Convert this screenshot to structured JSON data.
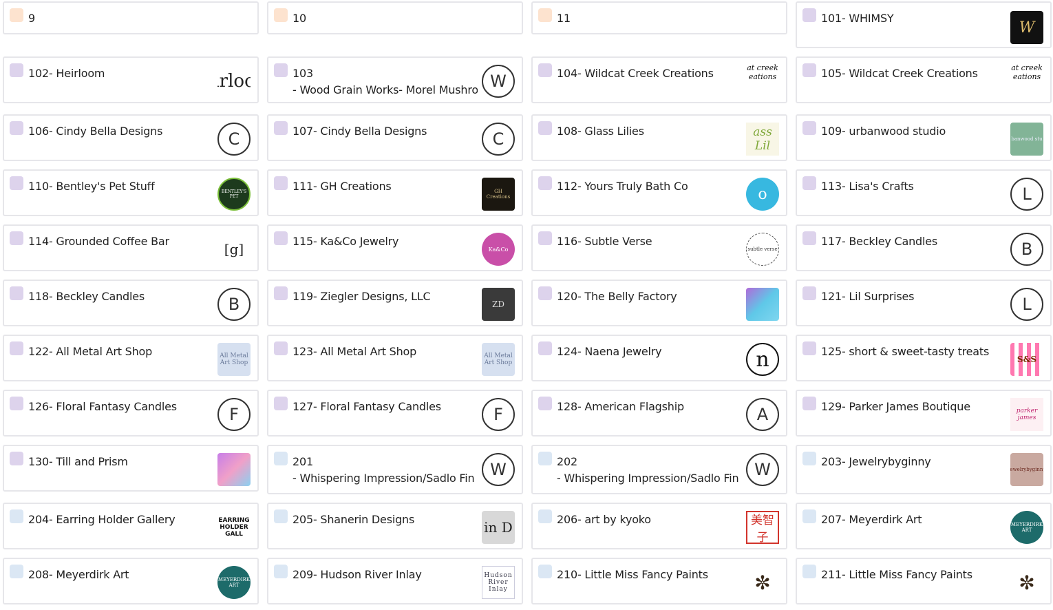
{
  "cards": [
    {
      "label": "9"
    },
    {
      "label": "10"
    },
    {
      "label": "11"
    },
    {
      "label": "101- WHIMSY",
      "thumb": "W"
    },
    {
      "label": "102- Heirloom",
      "thumb": "irloc"
    },
    {
      "label": "103",
      "label2": "- Wood Grain Works- Morel Mushro",
      "thumb": "W"
    },
    {
      "label": "104- Wildcat Creek Creations",
      "thumb": "at creek eations"
    },
    {
      "label": "105- Wildcat Creek Creations",
      "thumb": "at creek eations"
    },
    {
      "label": "106- Cindy Bella Designs",
      "thumb": "C"
    },
    {
      "label": "107- Cindy Bella Designs",
      "thumb": "C"
    },
    {
      "label": "108- Glass Lilies",
      "thumb": "ass Lil"
    },
    {
      "label": "109- urbanwood studio",
      "thumb": "banwood stu"
    },
    {
      "label": "110- Bentley's Pet Stuff",
      "thumb": "BENTLEY'S PET"
    },
    {
      "label": "111- GH Creations",
      "thumb": "GH Creations"
    },
    {
      "label": "112- Yours Truly Bath Co",
      "thumb": "o"
    },
    {
      "label": "113- Lisa's Crafts",
      "thumb": "L"
    },
    {
      "label": "114- Grounded Coffee Bar",
      "thumb": "[g]"
    },
    {
      "label": "115- Ka&Co Jewelry",
      "thumb": "Ka&Co"
    },
    {
      "label": "116- Subtle Verse",
      "thumb": "subtle verse"
    },
    {
      "label": "117- Beckley Candles",
      "thumb": "B"
    },
    {
      "label": "118- Beckley Candles",
      "thumb": "B"
    },
    {
      "label": "119- Ziegler Designs, LLC",
      "thumb": "ZD"
    },
    {
      "label": "120- The Belly Factory",
      "thumb": ""
    },
    {
      "label": "121- Lil Surprises",
      "thumb": "L"
    },
    {
      "label": "122- All Metal Art Shop",
      "thumb": "All Metal Art Shop"
    },
    {
      "label": "123- All Metal Art Shop",
      "thumb": "All Metal Art Shop"
    },
    {
      "label": "124- Naena Jewelry",
      "thumb": "n"
    },
    {
      "label": "125- short & sweet-tasty treats",
      "thumb": "S&S"
    },
    {
      "label": "126- Floral Fantasy Candles",
      "thumb": "F"
    },
    {
      "label": "127- Floral Fantasy Candles",
      "thumb": "F"
    },
    {
      "label": "128- American Flagship",
      "thumb": "A"
    },
    {
      "label": "129- Parker James Boutique",
      "thumb": "parker james"
    },
    {
      "label": "130- Till and Prism",
      "thumb": ""
    },
    {
      "label": "201",
      "label2": "- Whispering Impression/Sadlo Fin",
      "thumb": "W"
    },
    {
      "label": "202",
      "label2": "- Whispering Impression/Sadlo Fin",
      "thumb": "W"
    },
    {
      "label": "203- Jewelrybyginny",
      "thumb": "Jewelrybyginny"
    },
    {
      "label": "204- Earring Holder Gallery",
      "thumb": "EARRING HOLDER GALL"
    },
    {
      "label": "205- Shanerin Designs",
      "thumb": "in D"
    },
    {
      "label": "206- art by kyoko",
      "thumb": "美智 子"
    },
    {
      "label": "207- Meyerdirk Art",
      "thumb": "MEYERDIRK ART"
    },
    {
      "label": "208- Meyerdirk Art",
      "thumb": "MEYERDIRK ART"
    },
    {
      "label": "209- Hudson River Inlay",
      "thumb": "Hudson River Inlay"
    },
    {
      "label": "210- Little Miss Fancy Paints",
      "thumb": "✼"
    },
    {
      "label": "211- Little Miss Fancy Paints",
      "thumb": "✼"
    }
  ],
  "colors": {
    "checkbox_purple": "#ddd3ec",
    "checkbox_peach": "#fde3cf",
    "checkbox_blue": "#dbe7f4",
    "border": "#e6e6ea"
  }
}
